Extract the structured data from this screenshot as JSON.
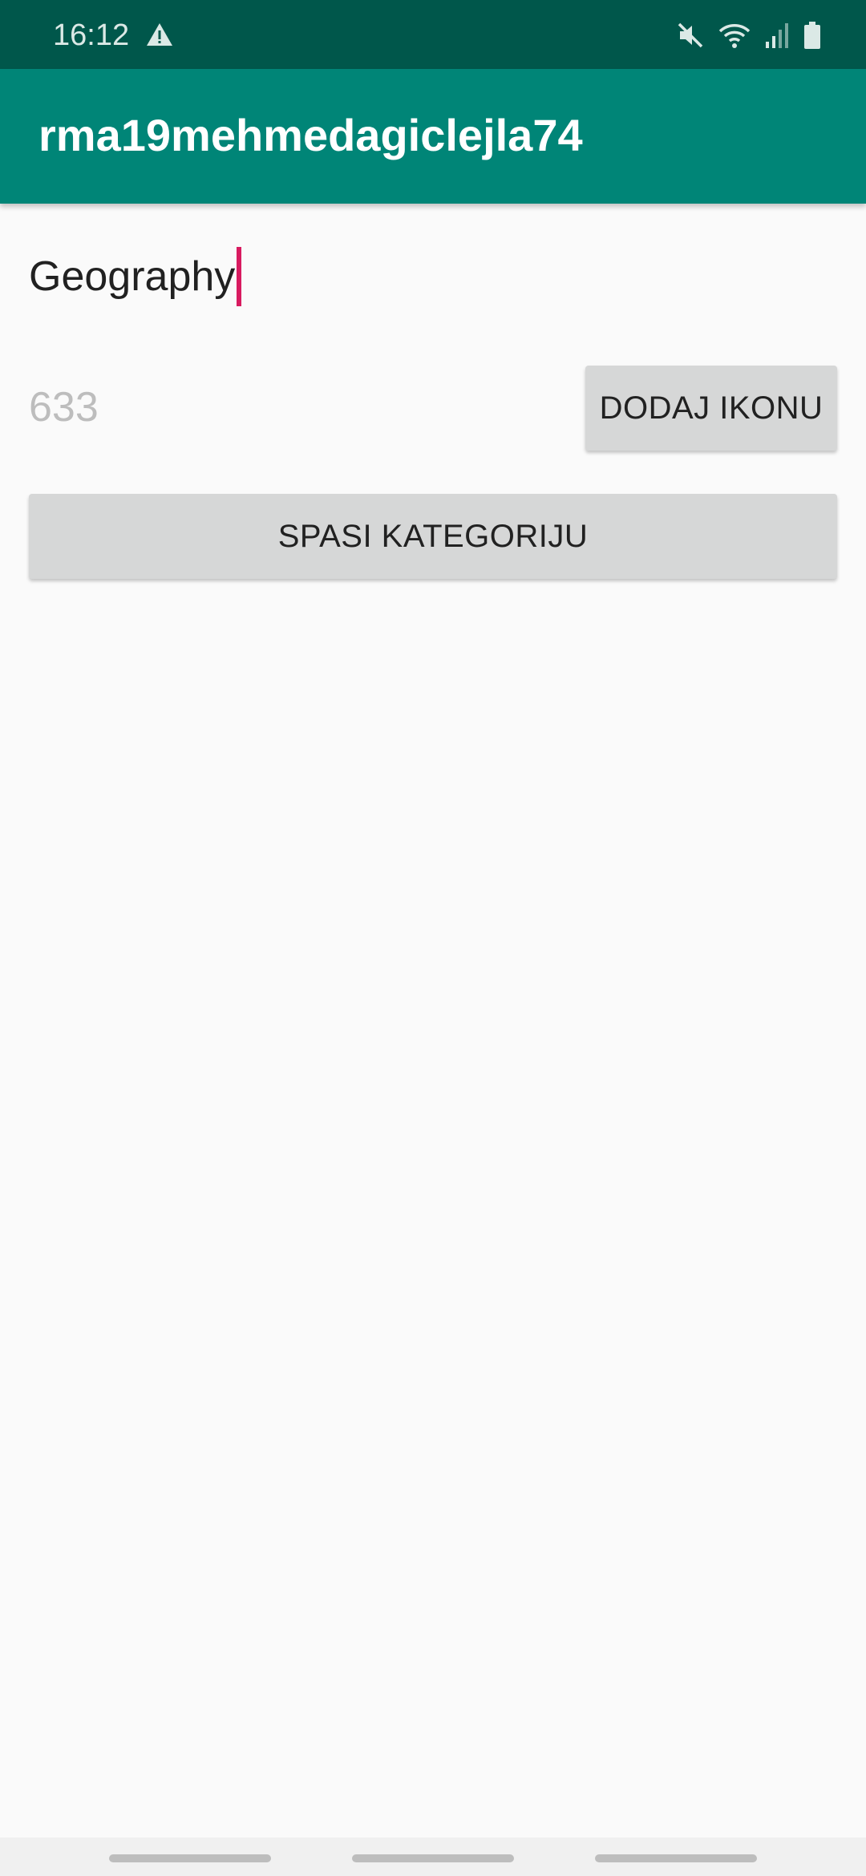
{
  "status_bar": {
    "time": "16:12",
    "icons": [
      "alert-icon",
      "mute-icon",
      "wifi-icon",
      "signal-icon",
      "battery-icon"
    ]
  },
  "app_bar": {
    "title": "rma19mehmedagiclejla74",
    "color": "#008577"
  },
  "form": {
    "category_name_value": "Geography",
    "icon_id_value": "633",
    "add_icon_label": "DODAJ IKONU",
    "save_category_label": "SPASI KATEGORIJU",
    "accent_color": "#d81b60"
  },
  "nav_bar": {
    "buttons": [
      "recent-apps",
      "home",
      "back"
    ]
  }
}
